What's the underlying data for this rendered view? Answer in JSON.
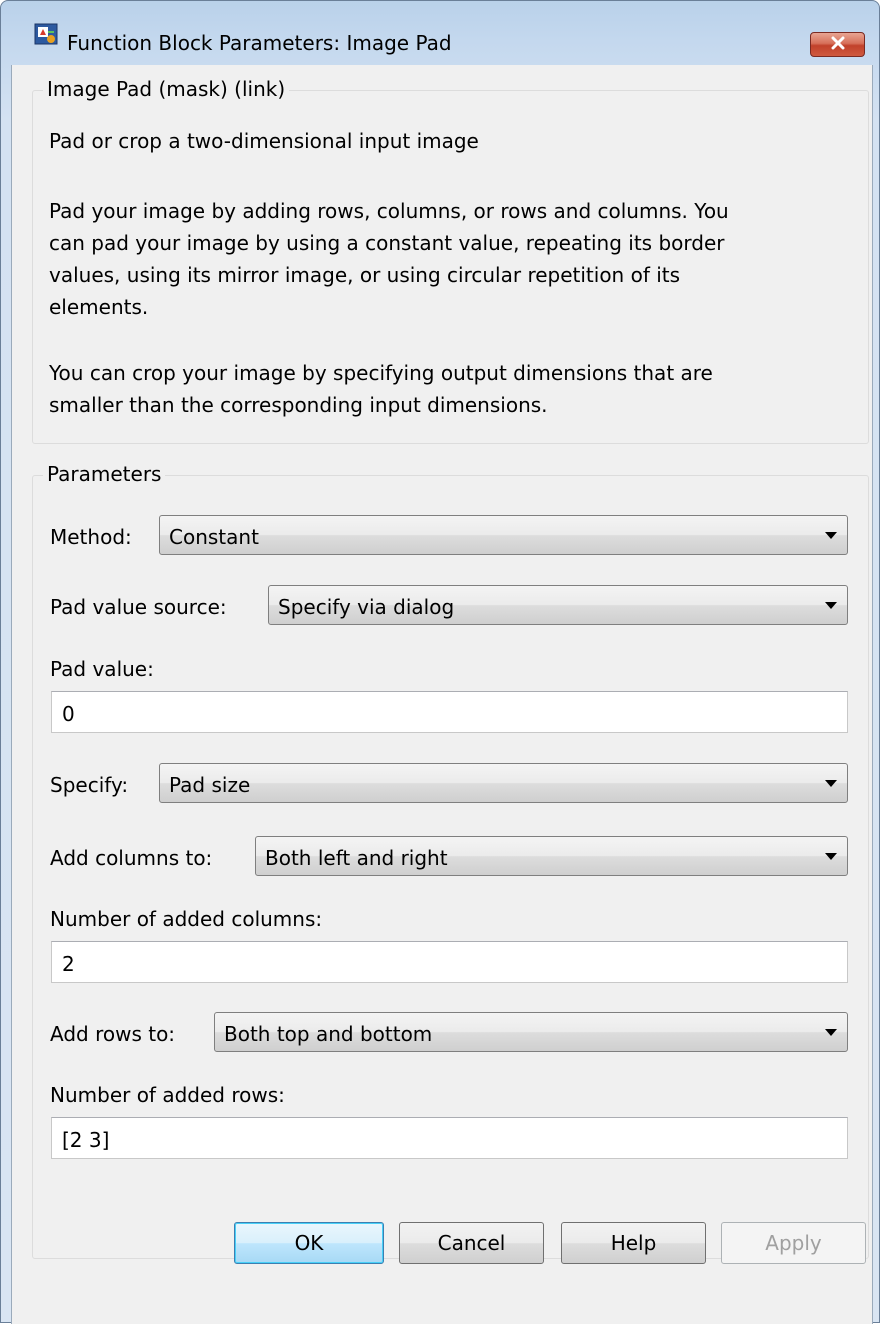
{
  "window": {
    "title": "Function Block Parameters: Image Pad",
    "icon": "simulink-block-icon",
    "close_icon": "close-x-icon"
  },
  "description": {
    "group_title": "Image Pad (mask) (link)",
    "summary": "Pad or crop a two-dimensional input image",
    "pad_paragraph_lines": [
      "Pad your image by adding rows, columns, or rows and columns.  You",
      "can pad your image by using a constant value, repeating its border",
      "values, using its mirror image, or using circular repetition of its",
      "elements."
    ],
    "crop_paragraph_lines": [
      "You can crop your image by specifying output dimensions that are",
      "smaller than the corresponding input dimensions."
    ]
  },
  "parameters": {
    "group_title": "Parameters",
    "method": {
      "label": "Method:",
      "value": "Constant"
    },
    "pad_value_source": {
      "label": "Pad value source:",
      "value": "Specify via dialog"
    },
    "pad_value": {
      "label": "Pad value:",
      "value": "0"
    },
    "specify": {
      "label": "Specify:",
      "value": "Pad size"
    },
    "add_columns_to": {
      "label": "Add columns to:",
      "value": "Both left and right"
    },
    "num_added_columns": {
      "label": "Number of added columns:",
      "value": "2"
    },
    "add_rows_to": {
      "label": "Add rows to:",
      "value": "Both top and bottom"
    },
    "num_added_rows": {
      "label": "Number of added rows:",
      "value": "[2 3]"
    }
  },
  "buttons": {
    "ok": "OK",
    "cancel": "Cancel",
    "help": "Help",
    "apply": "Apply"
  }
}
